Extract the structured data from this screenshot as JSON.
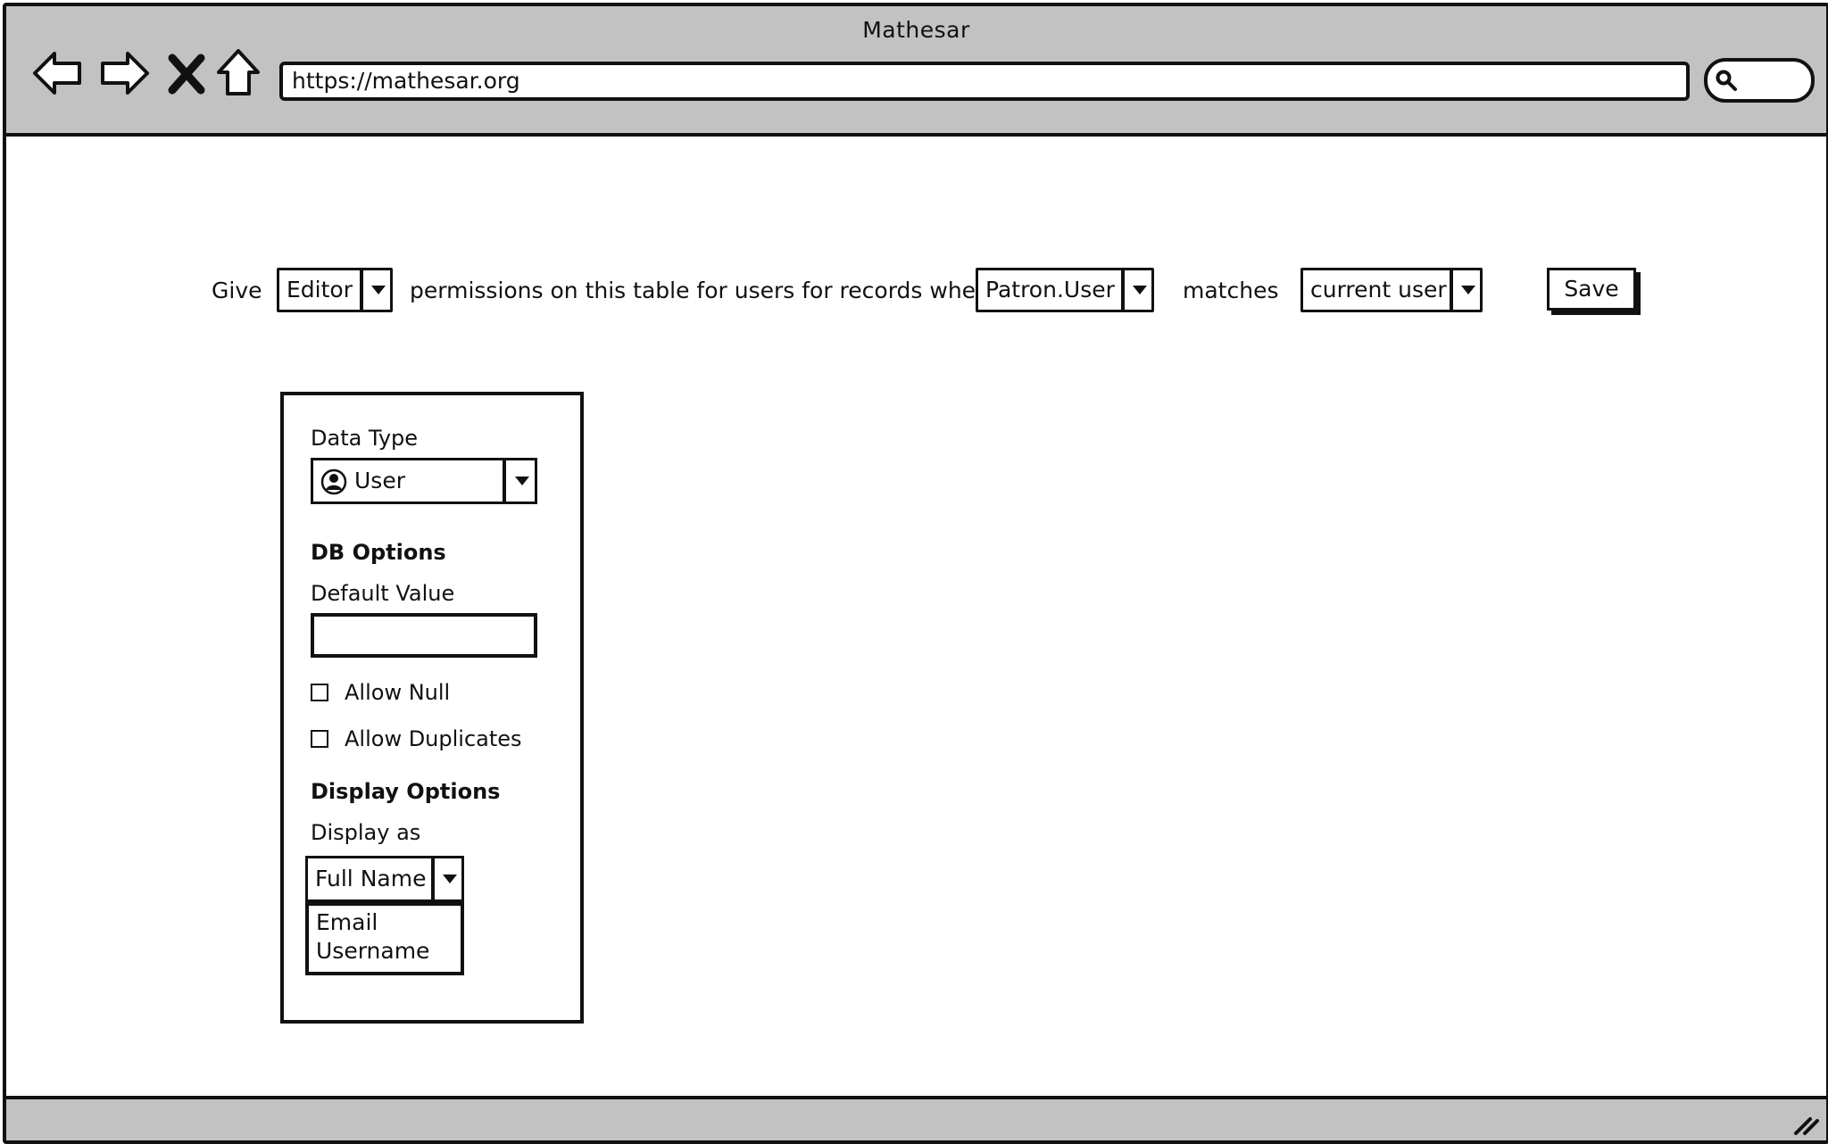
{
  "window": {
    "title": "Mathesar"
  },
  "browser": {
    "url": "https://mathesar.org",
    "nav": [
      "back-icon",
      "forward-icon",
      "close-icon",
      "home-icon"
    ],
    "search_icon": "search-icon"
  },
  "permission_rule": {
    "give_label": "Give",
    "role_value": "Editor",
    "middle_text": "permissions on this table for users for records where",
    "column_value": "Patron.User",
    "matches_label": "matches",
    "match_value": "current user",
    "save_label": "Save"
  },
  "column_panel": {
    "data_type_label": "Data Type",
    "data_type_value": "User",
    "data_type_icon": "user-icon",
    "db_options_heading": "DB Options",
    "default_value_label": "Default Value",
    "default_value": "",
    "allow_null_label": "Allow Null",
    "allow_null_checked": false,
    "allow_duplicates_label": "Allow Duplicates",
    "allow_duplicates_checked": false,
    "display_options_heading": "Display Options",
    "display_as_label": "Display as",
    "display_as_value": "Full Name",
    "display_as_options": [
      "Email",
      "Username"
    ]
  }
}
